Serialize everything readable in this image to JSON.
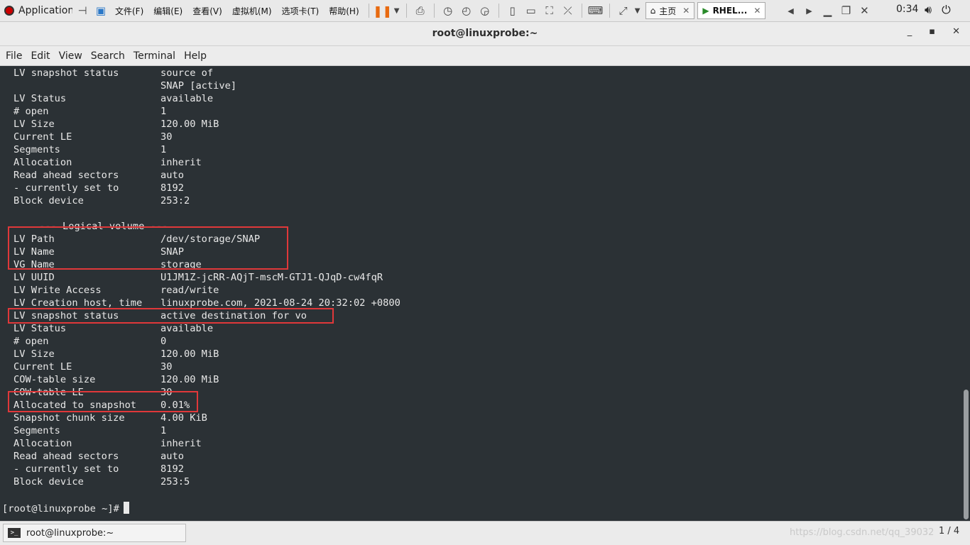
{
  "topbar": {
    "app_menu_label": "Applications",
    "menus": [
      "文件(F)",
      "编辑(E)",
      "查看(V)",
      "虚拟机(M)",
      "选项卡(T)",
      "帮助(H)"
    ],
    "tabs": [
      {
        "label": "主页",
        "active": false
      },
      {
        "label": "RHEL...",
        "active": true
      }
    ],
    "clock": "0:34"
  },
  "window": {
    "title": "root@linuxprobe:~"
  },
  "menubar": [
    "File",
    "Edit",
    "View",
    "Search",
    "Terminal",
    "Help"
  ],
  "terminal": {
    "lines": [
      {
        "label": "LV snapshot status",
        "value": "source of"
      },
      {
        "label": "",
        "value": "SNAP [active]"
      },
      {
        "label": "LV Status",
        "value": "available"
      },
      {
        "label": "# open",
        "value": "1"
      },
      {
        "label": "LV Size",
        "value": "120.00 MiB"
      },
      {
        "label": "Current LE",
        "value": "30"
      },
      {
        "label": "Segments",
        "value": "1"
      },
      {
        "label": "Allocation",
        "value": "inherit"
      },
      {
        "label": "Read ahead sectors",
        "value": "auto"
      },
      {
        "label": "- currently set to",
        "value": "8192"
      },
      {
        "label": "Block device",
        "value": "253:2"
      },
      {
        "label": "",
        "value": ""
      },
      {
        "section": "--- Logical volume ---"
      },
      {
        "label": "LV Path",
        "value": "/dev/storage/SNAP"
      },
      {
        "label": "LV Name",
        "value": "SNAP"
      },
      {
        "label": "VG Name",
        "value": "storage"
      },
      {
        "label": "LV UUID",
        "value": "U1JM1Z-jcRR-AQjT-mscM-GTJ1-QJqD-cw4fqR"
      },
      {
        "label": "LV Write Access",
        "value": "read/write"
      },
      {
        "label": "LV Creation host, time",
        "value": "linuxprobe.com, 2021-08-24 20:32:02 +0800"
      },
      {
        "label": "LV snapshot status",
        "value": "active destination for vo"
      },
      {
        "label": "LV Status",
        "value": "available"
      },
      {
        "label": "# open",
        "value": "0"
      },
      {
        "label": "LV Size",
        "value": "120.00 MiB"
      },
      {
        "label": "Current LE",
        "value": "30"
      },
      {
        "label": "COW-table size",
        "value": "120.00 MiB"
      },
      {
        "label": "COW-table LE",
        "value": "30"
      },
      {
        "label": "Allocated to snapshot",
        "value": "0.01%"
      },
      {
        "label": "Snapshot chunk size",
        "value": "4.00 KiB"
      },
      {
        "label": "Segments",
        "value": "1"
      },
      {
        "label": "Allocation",
        "value": "inherit"
      },
      {
        "label": "Read ahead sectors",
        "value": "auto"
      },
      {
        "label": "- currently set to",
        "value": "8192"
      },
      {
        "label": "Block device",
        "value": "253:5"
      }
    ],
    "prompt": "[root@linuxprobe ~]#",
    "highlight_color": "#e0383a"
  },
  "taskbar": {
    "item_label": "root@linuxprobe:~",
    "watermark": "https://blog.csdn.net/qq_39032",
    "workspace": "1 / 4"
  }
}
